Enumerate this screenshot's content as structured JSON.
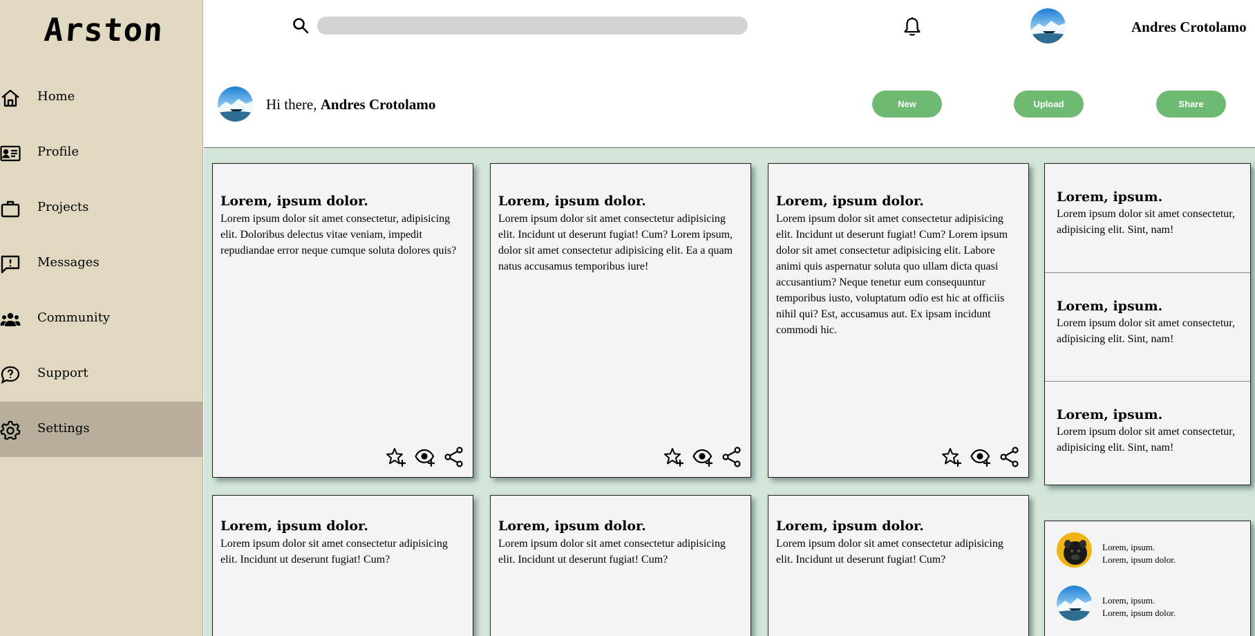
{
  "app": {
    "logo": "Arston"
  },
  "sidebar": {
    "items": [
      {
        "label": "Home",
        "icon": "home-icon"
      },
      {
        "label": "Profile",
        "icon": "id-card-icon"
      },
      {
        "label": "Projects",
        "icon": "briefcase-icon"
      },
      {
        "label": "Messages",
        "icon": "message-alert-icon"
      },
      {
        "label": "Community",
        "icon": "people-icon"
      },
      {
        "label": "Support",
        "icon": "help-chat-icon"
      },
      {
        "label": "Settings",
        "icon": "gear-icon",
        "active": true
      }
    ]
  },
  "header": {
    "search_placeholder": "",
    "search_value": "",
    "username": "Andres Crotolamo"
  },
  "greeting": {
    "prefix": "Hi there,",
    "name": "Andres Crotolamo"
  },
  "actions": {
    "new": "New",
    "upload": "Upload",
    "share": "Share"
  },
  "cards": [
    {
      "title": "Lorem, ipsum dolor.",
      "body": "Lorem ipsum dolor sit amet consectetur, adipisicing elit. Doloribus delectus vitae veniam, impedit repudiandae error neque cumque soluta dolores quis?"
    },
    {
      "title": "Lorem, ipsum dolor.",
      "body": "Lorem ipsum dolor sit amet consectetur adipisicing elit. Incidunt ut deserunt fugiat! Cum? Lorem ipsum, dolor sit amet consectetur adipisicing elit. Ea a quam natus accusamus temporibus iure!"
    },
    {
      "title": "Lorem, ipsum dolor.",
      "body": "Lorem ipsum dolor sit amet consectetur adipisicing elit. Incidunt ut deserunt fugiat! Cum? Lorem ipsum dolor sit amet consectetur adipisicing elit. Labore animi quis aspernatur soluta quo ullam dicta quasi accusantium? Neque tenetur eum consequuntur temporibus iusto, voluptatum odio est hic at officiis nihil qui? Est, accusamus aut. Ex ipsam incidunt commodi hic."
    },
    {
      "title": "Lorem, ipsum dolor.",
      "body": "Lorem ipsum dolor sit amet consectetur adipisicing elit. Incidunt ut deserunt fugiat! Cum?"
    },
    {
      "title": "Lorem, ipsum dolor.",
      "body": "Lorem ipsum dolor sit amet consectetur adipisicing elit. Incidunt ut deserunt fugiat! Cum?"
    },
    {
      "title": "Lorem, ipsum dolor.",
      "body": "Lorem ipsum dolor sit amet consectetur adipisicing elit. Incidunt ut deserunt fugiat! Cum?"
    }
  ],
  "card_actions": [
    "star-plus-icon",
    "eye-plus-icon",
    "share-icon"
  ],
  "announcements": [
    {
      "title": "Lorem, ipsum.",
      "body": "Lorem ipsum dolor sit amet consectetur, adipisicing elit. Sint, nam!"
    },
    {
      "title": "Lorem, ipsum.",
      "body": "Lorem ipsum dolor sit amet consectetur, adipisicing elit. Sint, nam!"
    },
    {
      "title": "Lorem, ipsum.",
      "body": "Lorem ipsum dolor sit amet consectetur, adipisicing elit. Sint, nam!"
    }
  ],
  "people": [
    {
      "name": "Lorem, ipsum.",
      "desc": "Lorem, ipsum dolor."
    },
    {
      "name": "Lorem, ipsum.",
      "desc": "Lorem, ipsum dolor."
    }
  ],
  "colors": {
    "sidebar_bg": "#e0d8c1",
    "sidebar_active": "#b7af9b",
    "main_bg": "#d4e6da",
    "card_bg": "#f4f4f4",
    "button_green": "#6fba72"
  }
}
